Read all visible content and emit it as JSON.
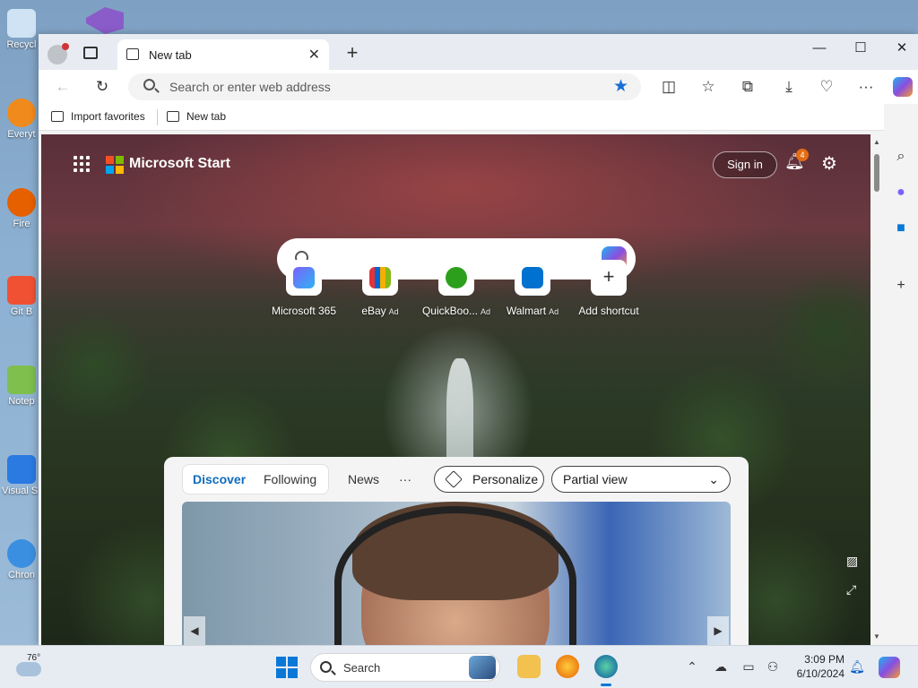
{
  "desktop": {
    "icons": [
      {
        "label": "Recycl",
        "color": "#cfe3f5"
      },
      {
        "label": "Everyt",
        "color": "#f08a1c"
      },
      {
        "label": "Fire",
        "color": "#e66000"
      },
      {
        "label": "Git B",
        "color": "#f05133"
      },
      {
        "label": "Notep",
        "color": "#7fbf4d"
      },
      {
        "label": "Visual S Co",
        "color": "#2a7ae2"
      },
      {
        "label": "Chron",
        "color": "#3a8fe0"
      }
    ]
  },
  "browser": {
    "tab": {
      "title": "New tab",
      "close": "✕"
    },
    "newtab_symbol": "+",
    "window_controls": {
      "minimize": "—",
      "maximize": "☐",
      "close": "✕"
    },
    "address_bar": {
      "placeholder": "Search or enter web address",
      "value": ""
    },
    "favorites_bar": [
      {
        "label": "Import favorites"
      },
      {
        "label": "New tab"
      }
    ]
  },
  "newtab_page": {
    "brand": "Microsoft Start",
    "sign_in": "Sign in",
    "notification_count": "4",
    "search_placeholder": "",
    "shortcuts": [
      {
        "name": "Microsoft 365",
        "ad": "",
        "color": "#7b61ff"
      },
      {
        "name": "eBay",
        "ad": "Ad",
        "color": "#e53238"
      },
      {
        "name": "QuickBoo...",
        "ad": "Ad",
        "color": "#2ca01c"
      },
      {
        "name": "Walmart",
        "ad": "Ad",
        "color": "#0071ce"
      },
      {
        "name": "Add shortcut",
        "ad": "",
        "color": "#ffffff"
      }
    ],
    "feed": {
      "tabs": [
        "Discover",
        "Following"
      ],
      "news": "News",
      "more": "···",
      "personalize": "Personalize",
      "view_select": "Partial view"
    }
  },
  "taskbar": {
    "temperature": "76°",
    "search_label": "Search",
    "time": "3:09 PM",
    "date": "6/10/2024"
  },
  "colors": {
    "accent": "#0f6cbd",
    "badge": "#e46d12",
    "star": "#1a6fd6"
  }
}
